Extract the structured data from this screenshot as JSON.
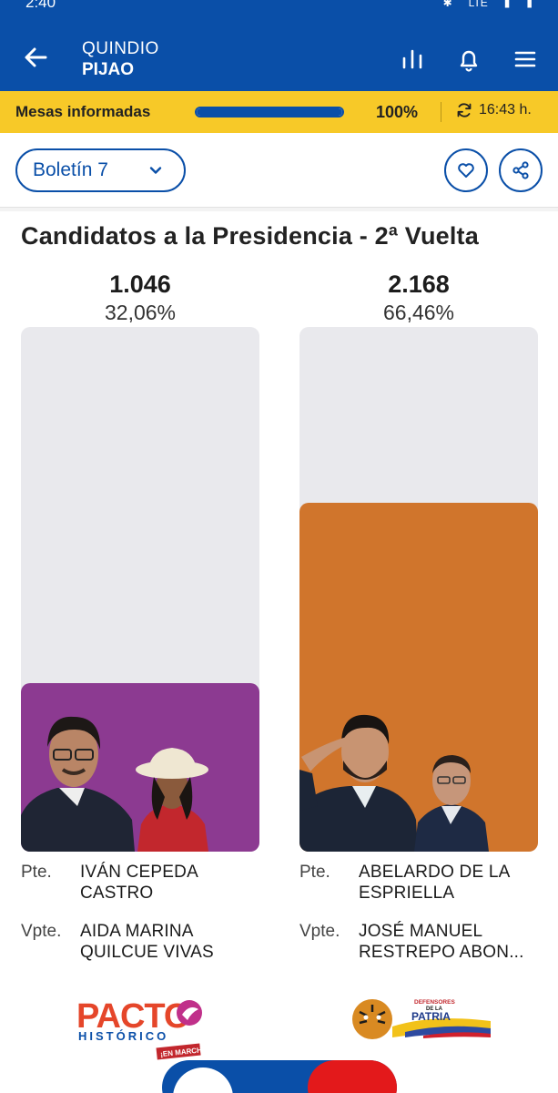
{
  "status_bar": {
    "time": "2:40",
    "network": "LTE"
  },
  "header": {
    "region": "QUINDIO",
    "municipality": "PIJAO"
  },
  "progress": {
    "label": "Mesas informadas",
    "percent_text": "100%",
    "fraction": 1.0,
    "updated_time": "16:43 h."
  },
  "toolbar": {
    "bulletin_label": "Boletín 7"
  },
  "section_title": "Candidatos a la Presidencia - 2ª Vuelta",
  "candidates": [
    {
      "votes": "1.046",
      "percent": "32,06%",
      "share": 0.3206,
      "color": "#8c3a91",
      "president_label": "Pte.",
      "president": "IVÁN CEPEDA CASTRO",
      "vp_label": "Vpte.",
      "vice_president": "AIDA MARINA QUILCUE VIVAS",
      "party_logo_text": "PACTO HISTÓRICO",
      "party_logo_sub": "¡EN MARCHA!"
    },
    {
      "votes": "2.168",
      "percent": "66,46%",
      "share": 0.6646,
      "color": "#d0752c",
      "president_label": "Pte.",
      "president": "ABELARDO DE LA ESPRIELLA",
      "vp_label": "Vpte.",
      "vice_president": "JOSÉ MANUEL RESTREPO ABON...",
      "party_logo_text": "DEFENSORES DE LA PATRIA"
    }
  ],
  "colors": {
    "primary": "#0a4fa8",
    "accent": "#f7c928",
    "track": "#e9e9ed",
    "fab_red": "#e3191b"
  }
}
